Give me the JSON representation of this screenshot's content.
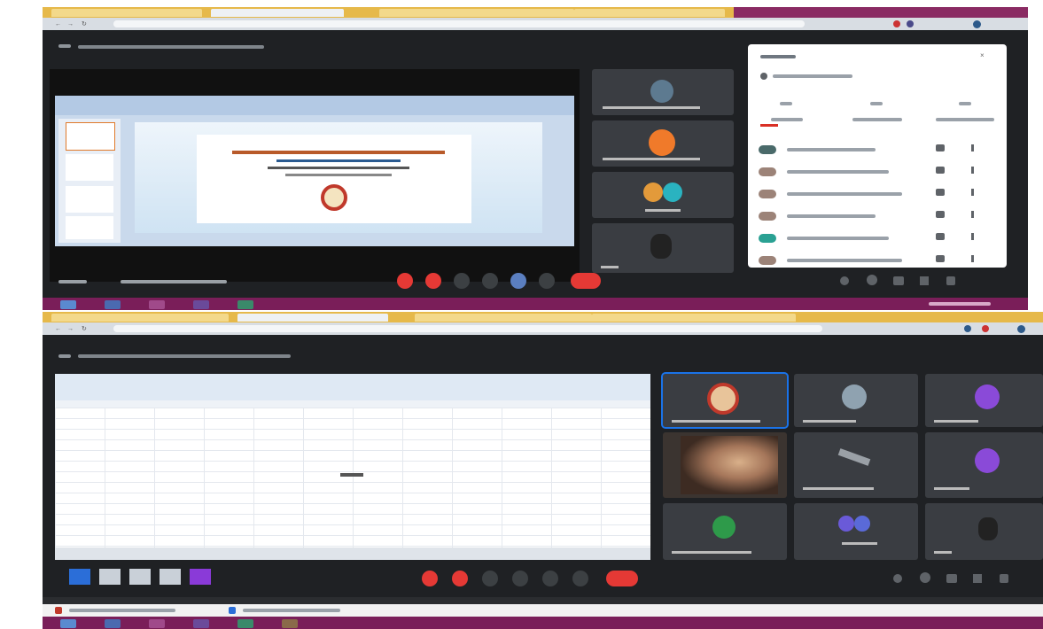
{
  "screens": [
    {
      "name": "meeting-1",
      "title": "",
      "participants_count": "",
      "presenter_label": "",
      "slide_text": "",
      "tiles": [
        {
          "name": "tile-1"
        },
        {
          "name": "tile-2"
        },
        {
          "name": "tile-3"
        },
        {
          "name": "tile-4"
        }
      ],
      "panel_title": "",
      "panel_rows": [
        {
          "color": "#4a6a6a"
        },
        {
          "color": "#9c8378"
        },
        {
          "color": "#9c8378"
        },
        {
          "color": "#9c8378"
        },
        {
          "color": "#2aa193"
        },
        {
          "color": "#9c8378"
        }
      ]
    },
    {
      "name": "meeting-2",
      "title": "",
      "doc_text": "",
      "tiles": [
        {
          "name": "tile-1"
        },
        {
          "name": "tile-2"
        },
        {
          "name": "tile-3"
        },
        {
          "name": "tile-4"
        },
        {
          "name": "tile-5"
        },
        {
          "name": "tile-6"
        },
        {
          "name": "tile-7"
        },
        {
          "name": "tile-8"
        },
        {
          "name": "tile-9"
        }
      ]
    }
  ],
  "colors": {
    "meet_bg": "#1f2124",
    "end_call": "#e53935",
    "mic_off": "#e53935",
    "accent_blue": "#1a73e8",
    "taskbar": "#7a1e59",
    "tabbar": "#e6b94a"
  },
  "icons": {
    "mic": "mic-off-icon",
    "camera": "camera-off-icon",
    "present": "present-icon",
    "end_call": "end-call-icon",
    "chat": "chat-icon",
    "people": "people-icon"
  }
}
